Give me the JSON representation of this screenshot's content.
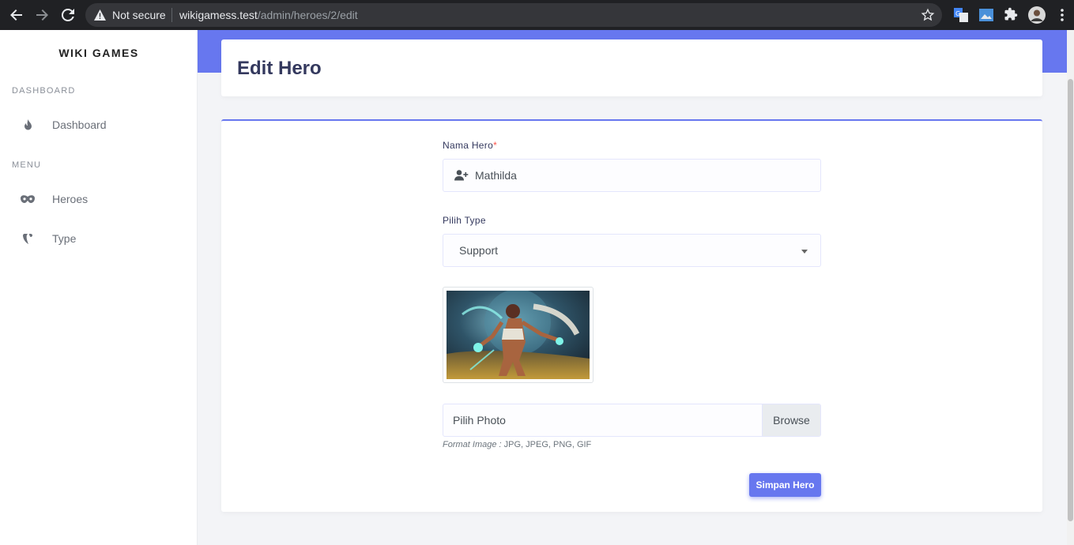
{
  "browser": {
    "security_label": "Not secure",
    "url_host": "wikigamess.test",
    "url_path": "/admin/heroes/2/edit"
  },
  "sidebar": {
    "brand": "WIKI GAMES",
    "section_dashboard": "DASHBOARD",
    "section_menu": "MENU",
    "items": [
      {
        "label": "Dashboard",
        "icon": "fire-icon"
      },
      {
        "label": "Heroes",
        "icon": "mask-icon"
      },
      {
        "label": "Type",
        "icon": "typo3-icon"
      }
    ]
  },
  "page": {
    "title": "Edit Hero"
  },
  "form": {
    "name_label": "Nama Hero",
    "required_mark": "*",
    "name_value": "Mathilda",
    "type_label": "Pilih Type",
    "type_value": "Support",
    "photo_placeholder": "Pilih Photo",
    "browse_label": "Browse",
    "hint_prefix": "Format Image :",
    "hint_formats": "JPG, JPEG, PNG, GIF",
    "submit_label": "Simpan Hero"
  },
  "colors": {
    "primary": "#6777ef",
    "danger": "#fc544b",
    "chrome": "#202124"
  }
}
